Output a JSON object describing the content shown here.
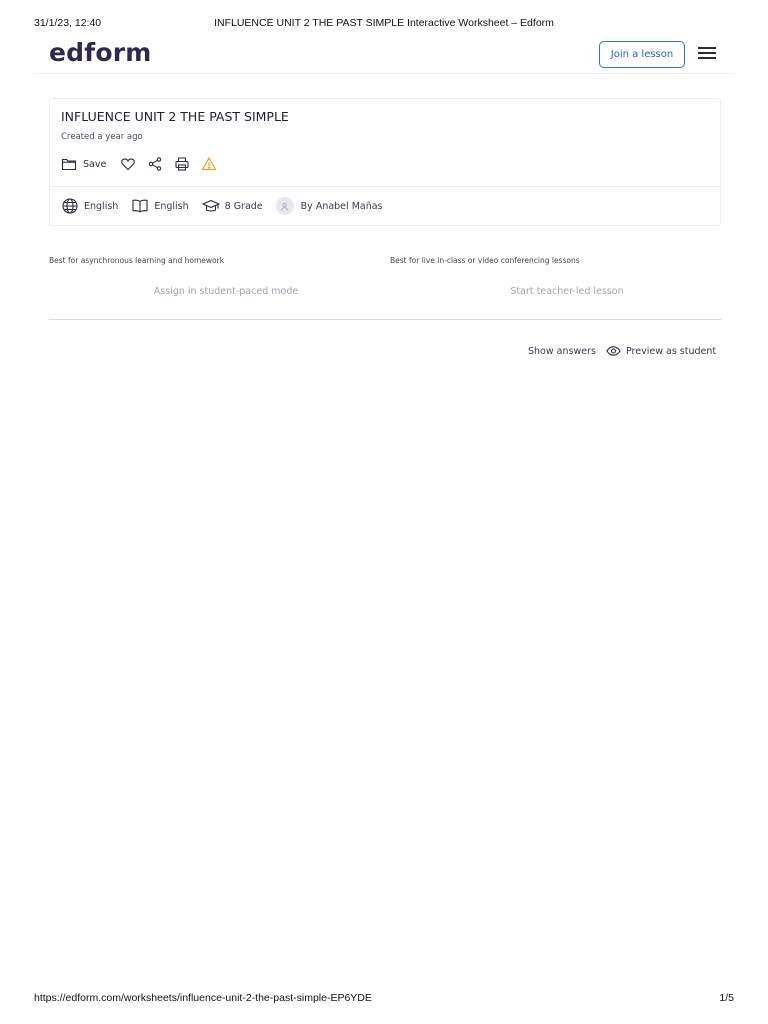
{
  "print_header": {
    "datetime": "31/1/23, 12:40",
    "page_title": "INFLUENCE UNIT 2 THE PAST SIMPLE Interactive Worksheet – Edform"
  },
  "print_footer": {
    "url": "https://edform.com/worksheets/influence-unit-2-the-past-simple-EP6YDE",
    "page_number": "1/5"
  },
  "header": {
    "logo": "edform",
    "join_label": "Join a lesson",
    "menu_icon": "hamburger-menu-icon"
  },
  "worksheet": {
    "title": "INFLUENCE UNIT 2 THE PAST SIMPLE",
    "created": "Created a year ago",
    "actions": {
      "save_label": "Save",
      "icons": [
        "folder-icon",
        "heart-icon",
        "share-icon",
        "print-icon",
        "warning-icon"
      ]
    },
    "meta": {
      "language": "English",
      "subject": "English",
      "grade": "8 Grade",
      "author": "By Anabel Mañas"
    }
  },
  "modes": {
    "async_note": "Best for asynchronous learning and homework",
    "async_button": "Assign in student-paced mode",
    "live_note": "Best for live in-class or video conferencing lessons",
    "live_button": "Start teacher-led lesson"
  },
  "controls": {
    "show_answers": "Show answers",
    "preview": "Preview as student"
  },
  "colors": {
    "brand": "#2e2a4f",
    "link_blue": "#1f5fd6",
    "warning": "#e8a317",
    "muted_text": "#a2a2ae"
  }
}
